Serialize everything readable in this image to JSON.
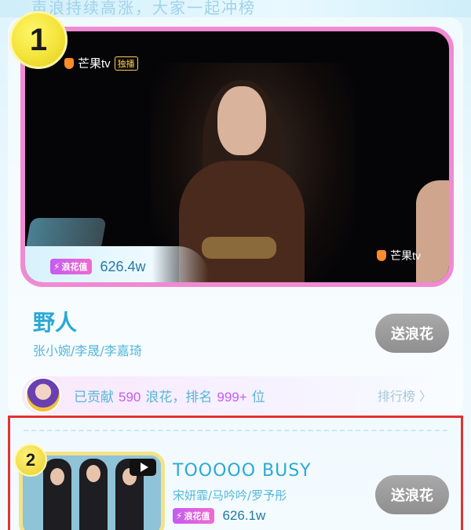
{
  "top_banner": {
    "text": "声浪持续高涨，大家一起冲榜"
  },
  "entries": [
    {
      "rank": "1",
      "channel_logo": "芒果tv",
      "live_tag": "独播",
      "watermark_logo": "芒果tv",
      "heat_badge": "浪花值",
      "heat_value": "626.4w",
      "title": "野人",
      "artists": "张小婉/李晟/李嘉琦",
      "send_button": "送浪花"
    },
    {
      "rank": "2",
      "heat_badge": "浪花值",
      "heat_value": "626.1w",
      "title": "TOOOOO BUSY",
      "artists": "宋妍霏/马吟吟/罗予彤",
      "send_button": "送浪花"
    }
  ],
  "contribution": {
    "prefix": "已贡献",
    "count": "590",
    "unit": "浪花，排名",
    "rank": "999+",
    "suffix": "位",
    "leaderboard_link": "排行榜 〉"
  },
  "colors": {
    "accent_blue": "#29a9d6",
    "accent_pink": "#f08ad2",
    "highlight_red": "#e23232"
  }
}
